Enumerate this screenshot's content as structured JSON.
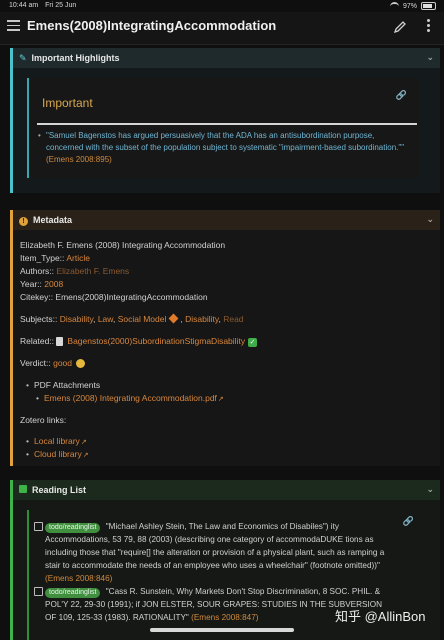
{
  "status": {
    "time": "10:44 am",
    "date": "Fri 25 Jun",
    "battery": "97%"
  },
  "header": {
    "title": "Emens(2008)IntegratingAccommodation"
  },
  "highlights": {
    "header": "Important Highlights",
    "title": "Important",
    "quote": "\"Samuel Bagenstos has argued persuasively that the ADA has an antisubordination purpose, concerned with the subset of the population subject to systematic \"impairment-based subordination.\"\"",
    "cite": "(Emens 2008:895)"
  },
  "metadata": {
    "header": "Metadata",
    "title_line": "Elizabeth F. Emens (2008) Integrating Accommodation",
    "item_type_label": "Item_Type::",
    "item_type_value": "Article",
    "authors_label": "Authors::",
    "authors_value": "Elizabeth F. Emens",
    "year_label": "Year::",
    "year_value": "2008",
    "citekey_line": "Citekey:: Emens(2008)IntegratingAccommodation",
    "subjects_label": "Subjects::",
    "subjects": [
      "Disability",
      "Law",
      "Social Model",
      "Disability",
      "Read"
    ],
    "related_label": "Related::",
    "related_value": "Bagenstos(2000)SubordinationStigmaDisability",
    "verdict_label": "Verdict::",
    "verdict_value": "good",
    "pdf_heading": "PDF Attachments",
    "pdf_file": "Emens (2008) Integrating Accommodation.pdf",
    "zotero_heading": "Zotero links:",
    "zotero_local": "Local library",
    "zotero_cloud": "Cloud library"
  },
  "reading_list": {
    "header": "Reading List",
    "items": [
      {
        "tag": "todo/readinglist",
        "text": "\"Michael Ashley Stein, The Law and Economics of Disabiles\") ity Accommodations, 53 79, 88 (2003) (describing one category of accommodaDUKE tions as including those that \"require[] the alteration or provision of a physical plant, such as ramping a stair to accommodate the needs of an employee who uses a wheelchair\" (footnote omitted))\"",
        "cite": "(Emens 2008:846)"
      },
      {
        "tag": "todo/readinglist",
        "text": "\"Cass R. Sunstein, Why Markets Don't Stop Discrimination, 8 SOC. PHIL. & POL'Y 22, 29-30 (1991); if JON ELSTER, SOUR GRAPES: STUDIES IN THE SUBVERSION OF 109, 125-33 (1983). RATIONALITY\"",
        "cite": "(Emens 2008:847)"
      }
    ]
  },
  "watermark": "知乎 @AllinBon"
}
